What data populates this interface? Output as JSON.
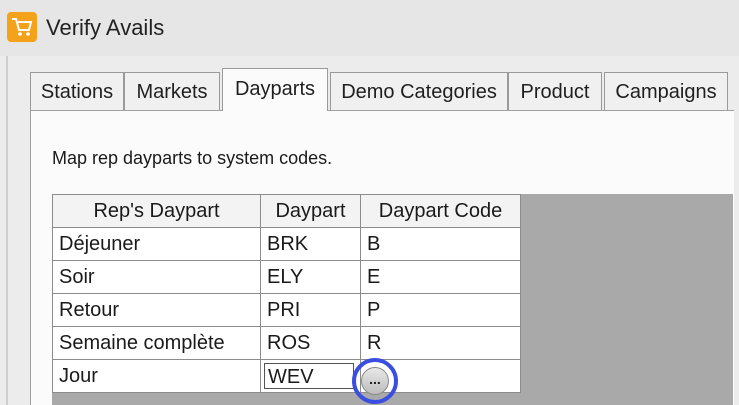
{
  "window": {
    "title": "Verify Avails"
  },
  "tabs": [
    {
      "label": "Stations"
    },
    {
      "label": "Markets"
    },
    {
      "label": "Dayparts"
    },
    {
      "label": "Demo Categories"
    },
    {
      "label": "Product"
    },
    {
      "label": "Campaigns"
    }
  ],
  "active_tab": "Dayparts",
  "panel": {
    "description": "Map rep dayparts to system codes."
  },
  "grid": {
    "columns": [
      "Rep's Daypart",
      "Daypart",
      "Daypart Code"
    ],
    "rows": [
      {
        "rep": "Déjeuner",
        "daypart": "BRK",
        "code": "B"
      },
      {
        "rep": "Soir",
        "daypart": "ELY",
        "code": "E"
      },
      {
        "rep": "Retour",
        "daypart": "PRI",
        "code": "P"
      },
      {
        "rep": "Semaine complète",
        "daypart": "ROS",
        "code": "R"
      },
      {
        "rep": "Jour",
        "daypart": "WEV",
        "code": ""
      }
    ]
  },
  "ellipsis_button": {
    "label": "..."
  },
  "colors": {
    "highlight_ring": "#3a4fe0",
    "app_icon": "#f4a21a"
  }
}
